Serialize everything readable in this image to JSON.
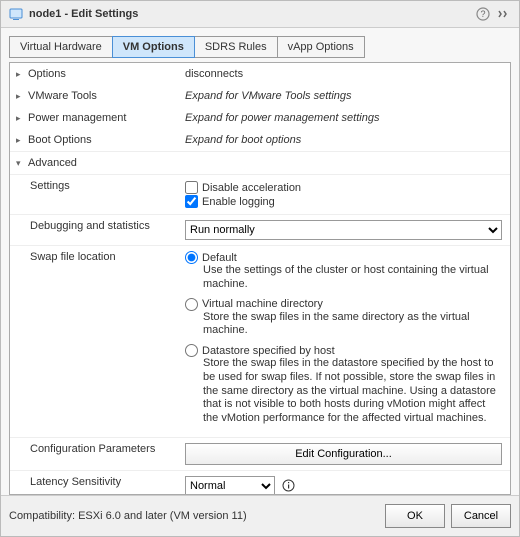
{
  "title": "node1 - Edit Settings",
  "tabs": {
    "hw": "Virtual Hardware",
    "vmopt": "VM Options",
    "sdrs": "SDRS Rules",
    "vapp": "vApp Options"
  },
  "sections": {
    "options_cut": "Options",
    "disconnects": "disconnects",
    "vmware_tools": "VMware Tools",
    "vmware_tools_expand": "Expand for VMware Tools settings",
    "power_mgmt": "Power management",
    "power_mgmt_expand": "Expand for power management settings",
    "boot": "Boot Options",
    "boot_expand": "Expand for boot options",
    "advanced": "Advanced"
  },
  "advanced": {
    "settings_label": "Settings",
    "disable_accel": "Disable acceleration",
    "enable_logging": "Enable logging",
    "debug_label": "Debugging and statistics",
    "debug_value": "Run normally",
    "swap_label": "Swap file location",
    "swap_default_title": "Default",
    "swap_default_desc": "Use the settings of the cluster or host containing the virtual machine.",
    "swap_vmdir_title": "Virtual machine directory",
    "swap_vmdir_desc": "Store the swap files in the same directory as the virtual machine.",
    "swap_host_title": "Datastore specified by host",
    "swap_host_desc": "Store the swap files in the datastore specified by the host to be used for swap files. If not possible, store the swap files in the same directory as the virtual machine. Using a datastore that is not visible to both hosts during vMotion might affect the vMotion performance for the affected virtual machines.",
    "config_params_label": "Configuration Parameters",
    "config_params_btn": "Edit Configuration...",
    "latency_label": "Latency Sensitivity",
    "latency_value": "Normal"
  },
  "footer": {
    "compat": "Compatibility: ESXi 6.0 and later (VM version 11)",
    "ok": "OK",
    "cancel": "Cancel"
  }
}
